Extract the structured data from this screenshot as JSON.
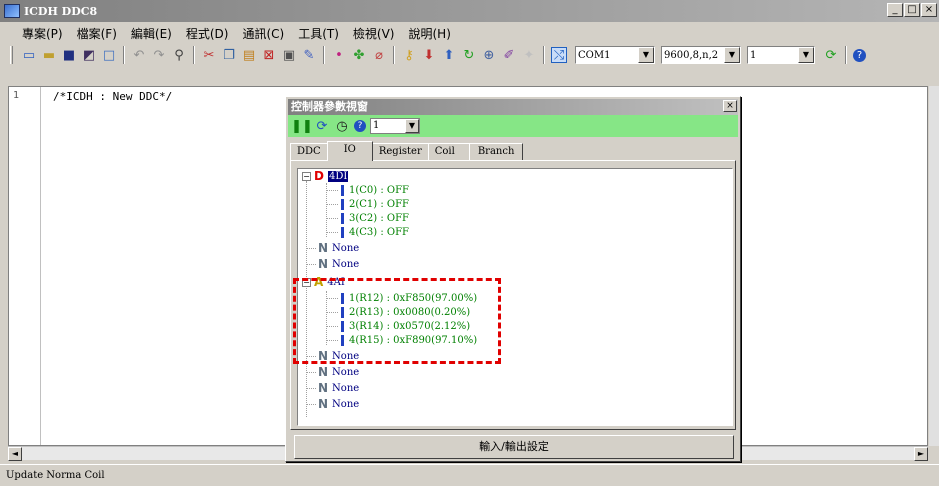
{
  "window": {
    "title": "ICDH DDC8",
    "minimize": "_",
    "maximize": "□",
    "close": "×"
  },
  "menu": [
    "專案(P)",
    "檔案(F)",
    "編輯(E)",
    "程式(D)",
    "通訊(C)",
    "工具(T)",
    "檢視(V)",
    "說明(H)"
  ],
  "toolbar": {
    "com_port": "COM1",
    "baud": "9600,8,n,2",
    "station": "1"
  },
  "editor": {
    "line_number": "1",
    "code": "/*ICDH : New DDC*/"
  },
  "dialog": {
    "title": "控制器參數視窗",
    "close": "×",
    "station": "1",
    "tabs": [
      "DDC",
      "IO",
      "Register",
      "Coil",
      "Branch"
    ],
    "active_tab": "IO",
    "tree": {
      "di": {
        "letter": "D",
        "label": "4DI",
        "items": [
          "1(C0) : OFF",
          "2(C1) : OFF",
          "3(C2) : OFF",
          "4(C3) : OFF"
        ]
      },
      "none1": {
        "letter": "N",
        "label": "None"
      },
      "none2": {
        "letter": "N",
        "label": "None"
      },
      "ai": {
        "letter": "A",
        "label": "4AI",
        "items": [
          "1(R12) : 0xF850(97.00%)",
          "2(R13) : 0x0080(0.20%)",
          "3(R14) : 0x0570(2.12%)",
          "4(R15) : 0xF890(97.10%)"
        ]
      },
      "none3": {
        "letter": "N",
        "label": "None"
      },
      "none4": {
        "letter": "N",
        "label": "None"
      },
      "none5": {
        "letter": "N",
        "label": "None"
      },
      "none6": {
        "letter": "N",
        "label": "None"
      }
    },
    "io_button": "輸入/輸出設定"
  },
  "status": {
    "text": "Update Norma Coil"
  },
  "colors": {
    "highlight": "#e00000",
    "dialog_toolbar": "#86e686",
    "value_text": "#008000"
  }
}
